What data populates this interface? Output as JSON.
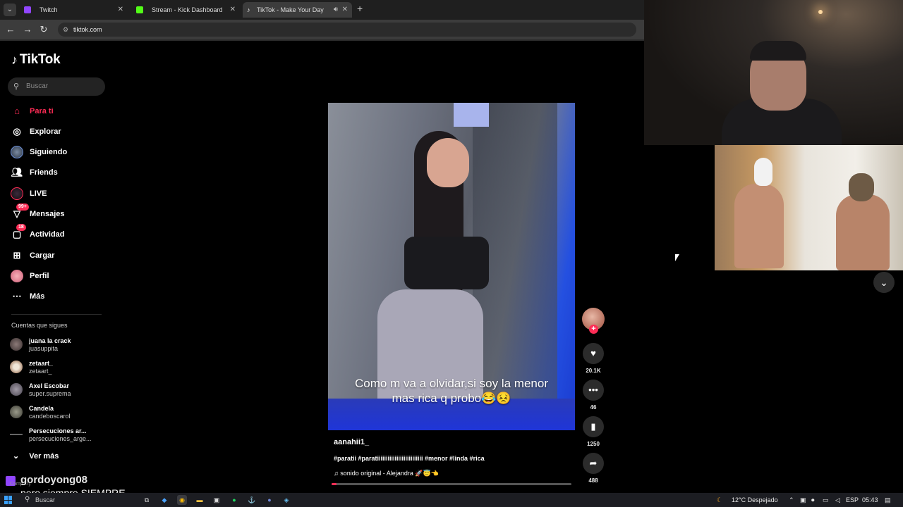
{
  "browser": {
    "tabs": [
      {
        "title": "Twitch",
        "favicon_color": "#9146ff"
      },
      {
        "title": "Stream - Kick Dashboard",
        "favicon_color": "#53fc18"
      },
      {
        "title": "TikTok - Make Your Day",
        "favicon_color": "#ffffff"
      }
    ],
    "new_tab": "+",
    "url": "tiktok.com"
  },
  "tiktok": {
    "logo": "TikTok",
    "search_placeholder": "Buscar",
    "nav": [
      {
        "label": "Para ti",
        "icon": "home-icon"
      },
      {
        "label": "Explorar",
        "icon": "compass-icon"
      },
      {
        "label": "Siguiendo",
        "icon": "following-icon"
      },
      {
        "label": "Friends",
        "icon": "friends-icon"
      },
      {
        "label": "LIVE",
        "icon": "live-icon"
      },
      {
        "label": "Mensajes",
        "icon": "messages-icon",
        "badge": "99+"
      },
      {
        "label": "Actividad",
        "icon": "activity-icon",
        "badge": "18"
      },
      {
        "label": "Cargar",
        "icon": "upload-icon"
      },
      {
        "label": "Perfil",
        "icon": "profile-icon"
      },
      {
        "label": "Más",
        "icon": "more-icon"
      }
    ],
    "following_title": "Cuentas que sigues",
    "following": [
      {
        "name": "juana la crack",
        "user": "juasuppita"
      },
      {
        "name": "zetaart_",
        "user": "zetaart_"
      },
      {
        "name": "Axel Escobar",
        "user": "super.suprema"
      },
      {
        "name": "Candela",
        "user": "candeboscarol"
      },
      {
        "name": "Persecuciones ar...",
        "user": "persecuciones_arge..."
      }
    ],
    "see_more": "Ver más",
    "video": {
      "caption_line1": "Como m va a olvidar,si soy la menor",
      "caption_line2": "mas rica q probo😂😣",
      "username": "aanahii1_",
      "description": "#paratii #paratiiiiiiiiiiiiiiiiiiiiiiiiii #menor #linda #rica",
      "sound": "sonido original - Alejandra 🚀😇👈",
      "progress": 0.02
    },
    "actions": {
      "likes": "20.1K",
      "comments": "46",
      "saves": "1250",
      "shares": "488"
    }
  },
  "stream": {
    "chat_user": "gordoyong08",
    "chat_message": "pero siempre SIEMPRE",
    "chat_company": "Company"
  },
  "taskbar": {
    "search": "Buscar",
    "weather": "12°C  Despejado",
    "lang": "ESP",
    "time": "05:43"
  }
}
